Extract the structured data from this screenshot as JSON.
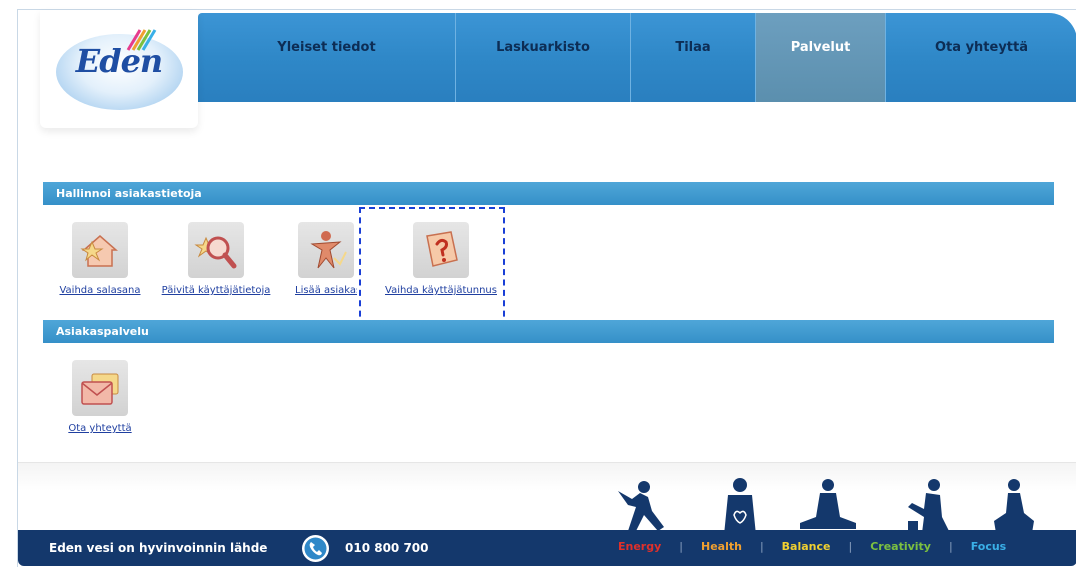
{
  "brand": {
    "logo_text": "Eden"
  },
  "nav": {
    "items": [
      {
        "label": "Yleiset tiedot",
        "active": false
      },
      {
        "label": "Laskuarkisto",
        "active": false
      },
      {
        "label": "Tilaa",
        "active": false
      },
      {
        "label": "Palvelut",
        "active": true
      },
      {
        "label": "Ota yhteyttä",
        "active": false
      }
    ]
  },
  "sections": {
    "manage": {
      "title": "Hallinnoi asiakastietoja",
      "tiles": [
        {
          "label": "Vaihda salasana",
          "icon": "house-star-icon"
        },
        {
          "label": "Päivitä käyttäjätietoja",
          "icon": "magnifier-star-icon"
        },
        {
          "label": "Lisää asiakas",
          "icon": "add-person-icon"
        },
        {
          "label": "Vaihda käyttäjätunnus",
          "icon": "question-book-icon"
        }
      ]
    },
    "service": {
      "title": "Asiakaspalvelu",
      "tiles": [
        {
          "label": "Ota yhteyttä",
          "icon": "envelope-icon"
        }
      ]
    }
  },
  "footer": {
    "tagline": "Eden vesi on hyvinvoinnin lähde",
    "phone": "010 800 700",
    "values": [
      {
        "label": "Energy",
        "color": "#e0302a"
      },
      {
        "label": "Health",
        "color": "#f0a030"
      },
      {
        "label": "Balance",
        "color": "#f0d030"
      },
      {
        "label": "Creativity",
        "color": "#7cc040"
      },
      {
        "label": "Focus",
        "color": "#3ab0e8"
      }
    ]
  },
  "colors": {
    "nav": "#2f88c8",
    "section_bar": "#3590c8",
    "footer": "#14386c",
    "link": "#1f3fa0"
  }
}
